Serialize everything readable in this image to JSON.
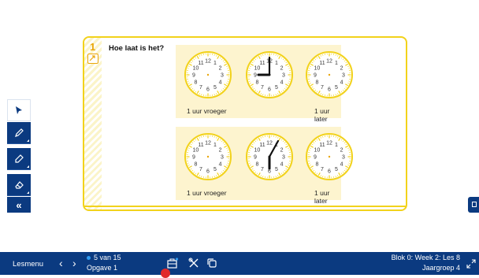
{
  "exercise": {
    "number": "1",
    "title": "Hoe laat is het?",
    "rows": [
      {
        "labels": {
          "left": "1 uur vroeger",
          "right": "1 uur later"
        },
        "center_time": "3:00"
      },
      {
        "labels": {
          "left": "1 uur vroeger",
          "right": "1 uur later"
        },
        "center_time": "6:07"
      }
    ]
  },
  "toolbar": {
    "tools": [
      "pointer-icon",
      "pencil-icon",
      "marker-icon",
      "eraser-icon"
    ],
    "collapse": "«"
  },
  "bottombar": {
    "menu": "Lesmenu",
    "prev": "‹",
    "next": "›",
    "position": "5 van 15",
    "task": "Opgave 1",
    "lesson": "Blok 0: Week 2: Les 8",
    "group": "Jaargroep 4"
  },
  "colors": {
    "accent_yellow": "#f2d21b",
    "panel_bg": "#fdf4cf",
    "navy": "#0b3a80"
  }
}
